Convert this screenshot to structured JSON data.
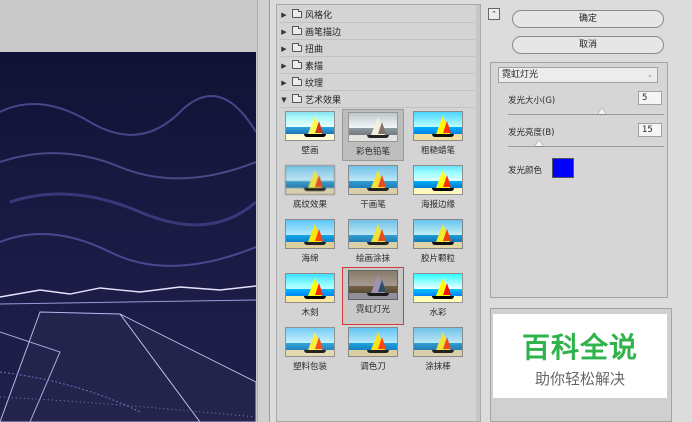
{
  "categories": [
    {
      "label": "风格化",
      "expanded": false
    },
    {
      "label": "画笔描边",
      "expanded": false
    },
    {
      "label": "扭曲",
      "expanded": false
    },
    {
      "label": "素描",
      "expanded": false
    },
    {
      "label": "纹理",
      "expanded": false
    },
    {
      "label": "艺术效果",
      "expanded": true
    }
  ],
  "filters": [
    {
      "label": "壁画"
    },
    {
      "label": "彩色铅笔"
    },
    {
      "label": "粗糙蜡笔"
    },
    {
      "label": "底纹效果"
    },
    {
      "label": "干画笔"
    },
    {
      "label": "海报边缘"
    },
    {
      "label": "海绵"
    },
    {
      "label": "绘画涂抹"
    },
    {
      "label": "胶片颗粒"
    },
    {
      "label": "木刻"
    },
    {
      "label": "霓虹灯光"
    },
    {
      "label": "水彩"
    },
    {
      "label": "塑料包装"
    },
    {
      "label": "调色刀"
    },
    {
      "label": "涂抹棒"
    }
  ],
  "selected_filter": "霓虹灯光",
  "buttons": {
    "ok": "确定",
    "cancel": "取消"
  },
  "settings": {
    "filter_select": "霓虹灯光",
    "glow_size_label": "发光大小(G)",
    "glow_size_value": "5",
    "glow_size_position": 0.6,
    "glow_brightness_label": "发光亮度(B)",
    "glow_brightness_value": "15",
    "glow_brightness_position": 0.2,
    "glow_color_label": "发光颜色",
    "glow_color": "#0000ff"
  },
  "watermark": {
    "title": "百科全说",
    "subtitle": "助你轻松解决",
    "title_color": "#2fb34a"
  }
}
